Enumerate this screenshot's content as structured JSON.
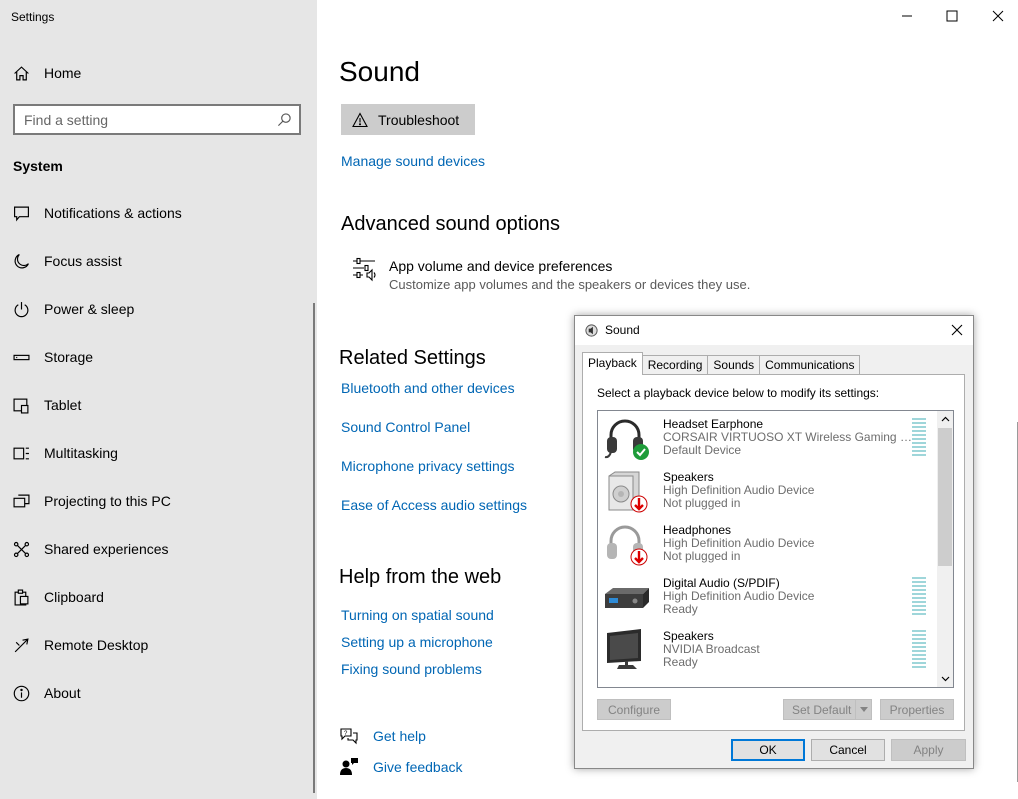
{
  "window": {
    "app_title": "Settings"
  },
  "sidebar": {
    "home_label": "Home",
    "search_placeholder": "Find a setting",
    "section_title": "System",
    "items": [
      {
        "label": "Notifications & actions",
        "icon": "notifications-icon"
      },
      {
        "label": "Focus assist",
        "icon": "moon-icon"
      },
      {
        "label": "Power & sleep",
        "icon": "power-icon"
      },
      {
        "label": "Storage",
        "icon": "storage-icon"
      },
      {
        "label": "Tablet",
        "icon": "tablet-icon"
      },
      {
        "label": "Multitasking",
        "icon": "multitasking-icon"
      },
      {
        "label": "Projecting to this PC",
        "icon": "projecting-icon"
      },
      {
        "label": "Shared experiences",
        "icon": "shared-experiences-icon"
      },
      {
        "label": "Clipboard",
        "icon": "clipboard-icon"
      },
      {
        "label": "Remote Desktop",
        "icon": "remote-desktop-icon"
      },
      {
        "label": "About",
        "icon": "info-icon"
      }
    ]
  },
  "main": {
    "title": "Sound",
    "troubleshoot_label": "Troubleshoot",
    "manage_devices_link": "Manage sound devices",
    "advanced": {
      "heading": "Advanced sound options",
      "item_title": "App volume and device preferences",
      "item_desc": "Customize app volumes and the speakers or devices they use."
    },
    "related": {
      "heading": "Related Settings",
      "links": [
        "Bluetooth and other devices",
        "Sound Control Panel",
        "Microphone privacy settings",
        "Ease of Access audio settings"
      ]
    },
    "help": {
      "heading": "Help from the web",
      "links": [
        "Turning on spatial sound",
        "Setting up a microphone",
        "Fixing sound problems"
      ]
    },
    "get_help": "Get help",
    "give_feedback": "Give feedback"
  },
  "dialog": {
    "title": "Sound",
    "tabs": [
      "Playback",
      "Recording",
      "Sounds",
      "Communications"
    ],
    "active_tab": "Playback",
    "instructions": "Select a playback device below to modify its settings:",
    "devices": [
      {
        "name": "Headset Earphone",
        "desc": "CORSAIR VIRTUOSO XT Wireless Gaming Receiver",
        "status": "Default Device",
        "icon": "headset-icon",
        "badge": "default-check-icon",
        "meter": true
      },
      {
        "name": "Speakers",
        "desc": "High Definition Audio Device",
        "status": "Not plugged in",
        "icon": "speaker-icon",
        "badge": "unplugged-arrow-icon",
        "meter": false
      },
      {
        "name": "Headphones",
        "desc": "High Definition Audio Device",
        "status": "Not plugged in",
        "icon": "headphones-icon",
        "badge": "unplugged-arrow-icon",
        "meter": false
      },
      {
        "name": "Digital Audio (S/PDIF)",
        "desc": "High Definition Audio Device",
        "status": "Ready",
        "icon": "digital-audio-icon",
        "badge": "",
        "meter": true
      },
      {
        "name": "Speakers",
        "desc": "NVIDIA Broadcast",
        "status": "Ready",
        "icon": "monitor-speaker-icon",
        "badge": "",
        "meter": true
      }
    ],
    "buttons": {
      "configure": "Configure",
      "set_default": "Set Default",
      "properties": "Properties",
      "ok": "OK",
      "cancel": "Cancel",
      "apply": "Apply"
    }
  },
  "colors": {
    "link": "#0066b4",
    "sidebar_bg": "#e6e6e6",
    "accent": "#0078d7"
  }
}
